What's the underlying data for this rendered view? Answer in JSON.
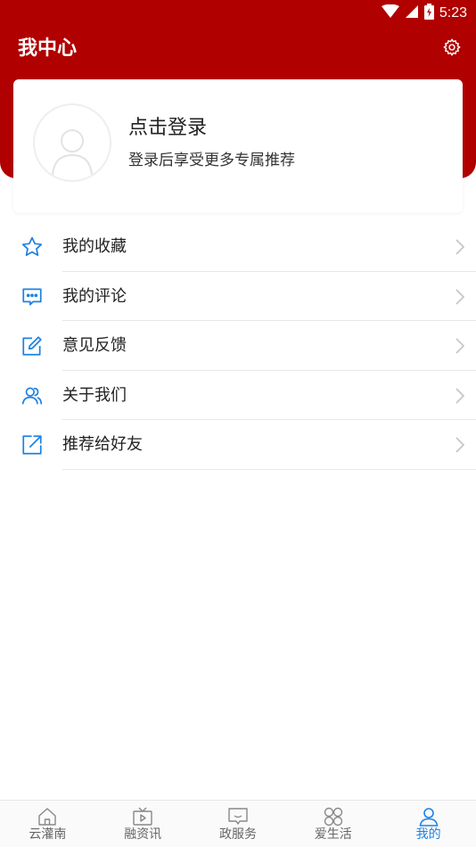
{
  "status_bar": {
    "time": "5:23",
    "icons": [
      "wifi-icon",
      "cell-signal-icon",
      "battery-icon"
    ]
  },
  "header": {
    "title": "我中心",
    "settings_icon": "gear-icon",
    "background_color": "#b00000"
  },
  "profile": {
    "login_title": "点击登录",
    "login_subtitle": "登录后享受更多专属推荐",
    "avatar_icon": "user-avatar-placeholder"
  },
  "menu": {
    "icon_color": "#1d82e6",
    "items": [
      {
        "label": "我的收藏",
        "icon": "star-icon"
      },
      {
        "label": "我的评论",
        "icon": "comment-icon"
      },
      {
        "label": "意见反馈",
        "icon": "edit-icon"
      },
      {
        "label": "关于我们",
        "icon": "users-icon"
      },
      {
        "label": "推荐给好友",
        "icon": "share-icon"
      }
    ]
  },
  "tab_bar": {
    "active_color": "#1d82e6",
    "active_index": 4,
    "tabs": [
      {
        "label": "云灌南",
        "icon": "home-icon"
      },
      {
        "label": "融资讯",
        "icon": "tv-icon"
      },
      {
        "label": "政服务",
        "icon": "message-icon"
      },
      {
        "label": "爱生活",
        "icon": "clover-icon"
      },
      {
        "label": "我的",
        "icon": "person-icon"
      }
    ]
  }
}
